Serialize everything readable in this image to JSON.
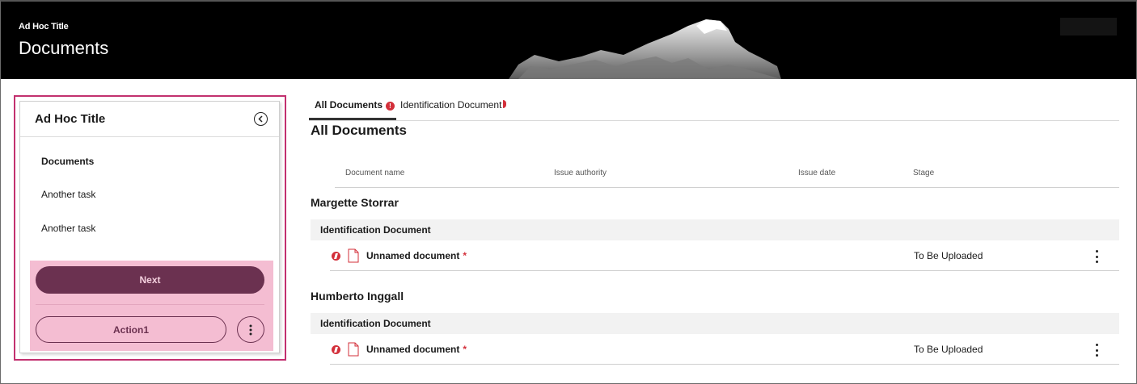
{
  "header": {
    "subtitle": "Ad Hoc Title",
    "title": "Documents"
  },
  "sidebar": {
    "title": "Ad Hoc Title",
    "items": [
      {
        "label": "Documents",
        "active": true
      },
      {
        "label": "Another task",
        "active": false
      },
      {
        "label": "Another task",
        "active": false
      }
    ],
    "next_label": "Next",
    "action_label": "Action1"
  },
  "tabs": [
    {
      "label": "All Documents",
      "active": true,
      "error": true
    },
    {
      "label": "Identification Document",
      "active": false,
      "error": true
    }
  ],
  "main": {
    "section_title": "All Documents",
    "columns": [
      "Document name",
      "Issue authority",
      "Issue date",
      "Stage"
    ],
    "people": [
      {
        "name": "Margette Storrar",
        "group": "Identification Document",
        "doc_name": "Unnamed document",
        "required_mark": "*",
        "stage": "To Be Uploaded"
      },
      {
        "name": "Humberto Inggall",
        "group": "Identification Document",
        "doc_name": "Unnamed document",
        "required_mark": "*",
        "stage": "To Be Uploaded"
      }
    ]
  },
  "colors": {
    "accent": "#6b3150",
    "highlight": "#f4bdd2",
    "outline": "#c2306f",
    "error": "#d32f3a"
  }
}
